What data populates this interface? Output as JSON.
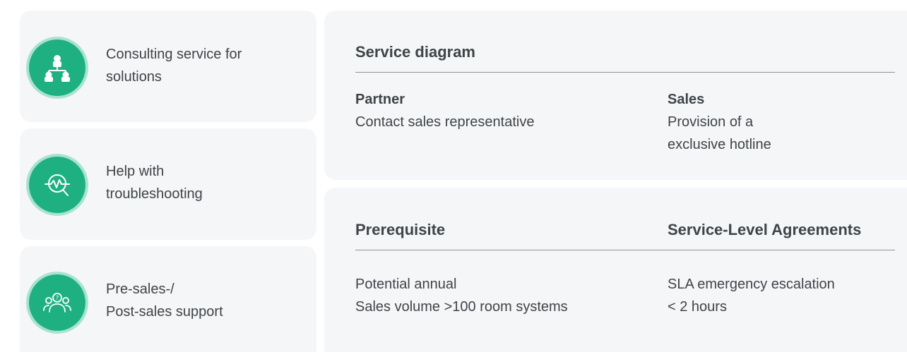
{
  "left_cards": [
    {
      "label": "Consulting service for\nsolutions",
      "icon": "org-chart-icon"
    },
    {
      "label": "Help with\ntroubleshooting",
      "icon": "diagnostics-icon"
    },
    {
      "label": "Pre-sales-/\nPost-sales support",
      "icon": "people-support-icon"
    }
  ],
  "service_panel": {
    "title": "Service diagram",
    "partner": {
      "heading": "Partner",
      "text": "Contact sales representative"
    },
    "sales": {
      "heading": "Sales",
      "text": "Provision of a\nexclusive hotline"
    }
  },
  "requirements_panel": {
    "prerequisite": {
      "title": "Prerequisite",
      "text": "Potential annual\nSales volume >100 room systems"
    },
    "sla": {
      "title": "Service-Level Agreements",
      "text": "SLA emergency escalation\n< 2 hours"
    }
  },
  "colors": {
    "card_bg": "#f5f6f7",
    "icon_green": "#1fb082",
    "icon_ring": "#a8e3cf",
    "text": "#3f4448",
    "divider": "#8e9296"
  }
}
